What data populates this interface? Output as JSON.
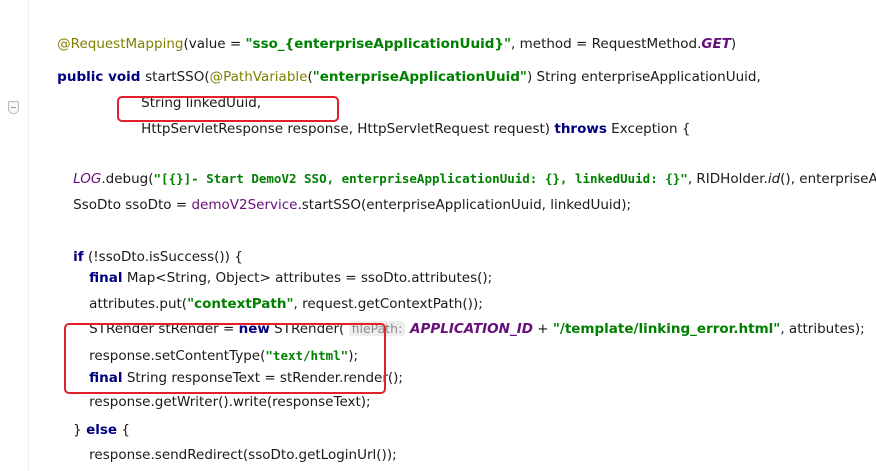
{
  "code": {
    "l1": {
      "anno": "@RequestMapping",
      "p1": "(value = ",
      "str": "\"sso_{enterpriseApplicationUuid}\"",
      "p2": ", method = RequestMethod.",
      "const": "GET",
      "p3": ")"
    },
    "l2": {
      "kw": "public void ",
      "p1": "startSSO(",
      "anno": "@PathVariable",
      "p2": "(",
      "str": "\"enterpriseApplicationUuid\"",
      "p3": ") String enterpriseApplicationUuid,"
    },
    "l3": {
      "p1": "String linkedUuid,"
    },
    "l4": {
      "p1": "HttpServletResponse response,",
      "p2": " HttpServletRequest request) ",
      "kw": "throws",
      "p3": " Exception {"
    },
    "l5": {
      "log": "LOG",
      "p1": ".debug(",
      "str": "\"[{}]- Start DemoV2 SSO, enterpriseApplicationUuid: {}, linkedUuid: {}\"",
      "p2": ", RIDHolder.",
      "it": "id",
      "p3": "(), enterpriseApp"
    },
    "l6": {
      "p1": "SsoDto ssoDto = ",
      "field": "demoV2Service",
      "p2": ".startSSO(enterpriseApplicationUuid, linkedUuid);"
    },
    "l7": {
      "kw": "if",
      "p1": " (!ssoDto.isSuccess()) {"
    },
    "l8": {
      "kw": "final",
      "p1": " Map<String, Object> attributes = ssoDto.attributes();"
    },
    "l9": {
      "p1": "attributes.put(",
      "str": "\"contextPath\"",
      "p2": ", request.getContextPath());"
    },
    "l10": {
      "p1": "STRender stRender = ",
      "kw": "new",
      "p2": " STRender( ",
      "hint": "filePath:",
      "const": " APPLICATION_ID",
      "p3": " + ",
      "str": "\"/template/linking_error.html\"",
      "p4": ", attributes);"
    },
    "l11": {
      "p1": "response.setContentType(",
      "str": "\"text/html\"",
      "p2": ");"
    },
    "l12": {
      "kw": "final",
      "p1": " String responseText = stRender.render();"
    },
    "l13": {
      "p1": "response.getWriter().write(responseText);"
    },
    "l14": {
      "p1": "} ",
      "kw": "else",
      "p2": " {"
    },
    "l15": {
      "p1": "response.sendRedirect(ssoDto.getLoginUrl());"
    },
    "l16": {
      "p1": "}"
    }
  },
  "colors": {
    "annotation": "#808000",
    "keyword": "#000080",
    "string": "#008000",
    "constant": "#660e7a",
    "highlight_box": "#e0202a"
  }
}
